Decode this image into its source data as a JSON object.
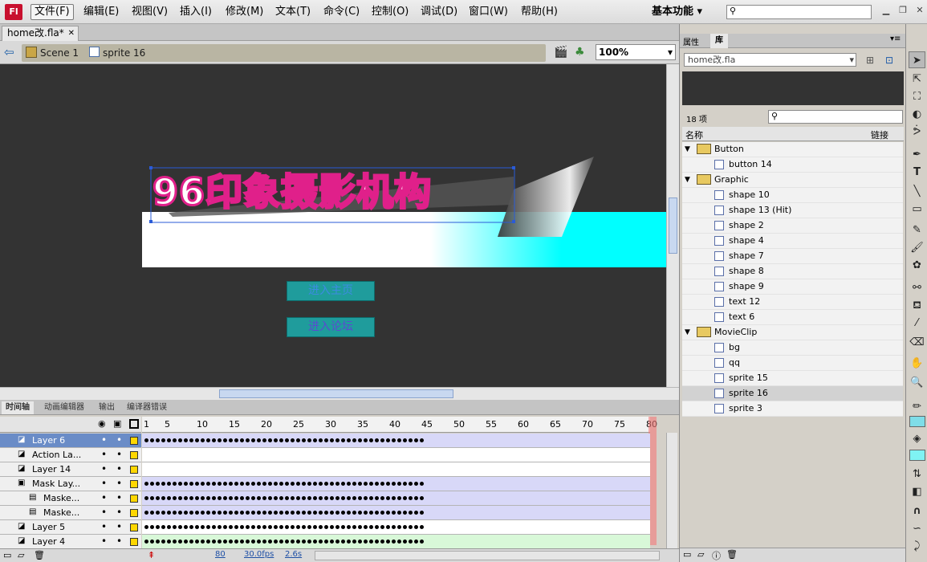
{
  "app": {
    "logo": "Fl",
    "workspace": "基本功能"
  },
  "menu": [
    "文件(F)",
    "编辑(E)",
    "视图(V)",
    "插入(I)",
    "修改(M)",
    "文本(T)",
    "命令(C)",
    "控制(O)",
    "调试(D)",
    "窗口(W)",
    "帮助(H)"
  ],
  "document": {
    "tab": "home改.fla*",
    "scene": "Scene 1",
    "symbol": "sprite 16",
    "zoom": "100%"
  },
  "stage": {
    "title_text": "96印象摄影机构",
    "buttons": [
      "进入主页",
      "进入论坛"
    ]
  },
  "timeline": {
    "tabs": [
      "时间轴",
      "动画编辑器",
      "输出",
      "编译器错误"
    ],
    "ruler": [
      "1",
      "5",
      "10",
      "15",
      "20",
      "25",
      "30",
      "35",
      "40",
      "45",
      "50",
      "55",
      "60",
      "65",
      "70",
      "75",
      "80"
    ],
    "layers": [
      {
        "name": "Layer 6",
        "selected": true
      },
      {
        "name": "Action La..."
      },
      {
        "name": "Layer 14"
      },
      {
        "name": "Mask Lay..."
      },
      {
        "name": "Maske..."
      },
      {
        "name": "Maske..."
      },
      {
        "name": "Layer 5"
      },
      {
        "name": "Layer 4"
      }
    ],
    "status": {
      "frame": "80",
      "fps": "30.0fps",
      "time": "2.6s"
    }
  },
  "panel": {
    "tabs": [
      "属性",
      "库"
    ],
    "library_file": "home改.fla",
    "count": "18 项",
    "col_name": "名称",
    "col_link": "链接",
    "items": [
      {
        "label": "Button",
        "folder": true
      },
      {
        "label": "button 14",
        "folder": false
      },
      {
        "label": "Graphic",
        "folder": true
      },
      {
        "label": "shape 10",
        "folder": false
      },
      {
        "label": "shape 13 (Hit)",
        "folder": false
      },
      {
        "label": "shape 2",
        "folder": false
      },
      {
        "label": "shape 4",
        "folder": false
      },
      {
        "label": "shape 7",
        "folder": false
      },
      {
        "label": "shape 8",
        "folder": false
      },
      {
        "label": "shape 9",
        "folder": false
      },
      {
        "label": "text 12",
        "folder": false
      },
      {
        "label": "text 6",
        "folder": false
      },
      {
        "label": "MovieClip",
        "folder": true
      },
      {
        "label": "bg",
        "folder": false
      },
      {
        "label": "qq",
        "folder": false
      },
      {
        "label": "sprite 15",
        "folder": false
      },
      {
        "label": "sprite 16",
        "folder": false,
        "selected": true
      },
      {
        "label": "sprite 3",
        "folder": false
      }
    ]
  },
  "colors": {
    "accent": "#00b3b3",
    "title_pink": "#e0208a",
    "stage_bg": "#333333"
  }
}
